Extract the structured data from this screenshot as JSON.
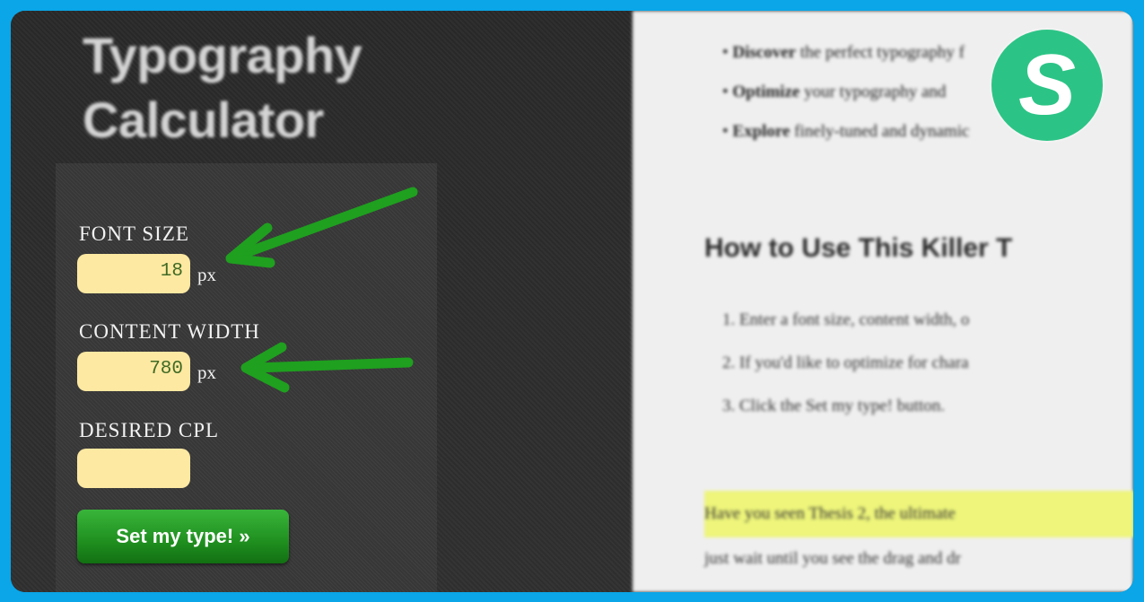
{
  "calculator": {
    "title_line1": "Typography",
    "title_line2": "Calculator",
    "font_size": {
      "label": "FONT SIZE",
      "value": "18",
      "unit": "px"
    },
    "content_width": {
      "label": "CONTENT WIDTH",
      "value": "780",
      "unit": "px"
    },
    "desired_cpl": {
      "label": "DESIRED CPL",
      "value": ""
    },
    "submit_label": "Set my type! »"
  },
  "article": {
    "bullets": [
      {
        "bold": "Discover",
        "rest": " the perfect typography f"
      },
      {
        "bold": "Optimize",
        "rest": " your typography and"
      },
      {
        "bold": "Explore",
        "rest": " finely-tuned and dynamic"
      }
    ],
    "heading": "How to Use This Killer T",
    "steps": [
      "1. Enter a font size, content width, o",
      "2. If you'd like to optimize for chara",
      "3. Click the Set my type! button."
    ],
    "highlight_text": "Have you seen Thesis 2, the ultimate",
    "last_line": "just wait until you see the drag and dr"
  },
  "logo": {
    "letter": "S"
  },
  "colors": {
    "frame_border": "#0aa6e8",
    "input_bg": "#fee9a2",
    "button_green": "#1f8f1f",
    "arrow_green": "#1fa01f",
    "logo_green": "#2cc486",
    "highlight": "#eef57a"
  }
}
